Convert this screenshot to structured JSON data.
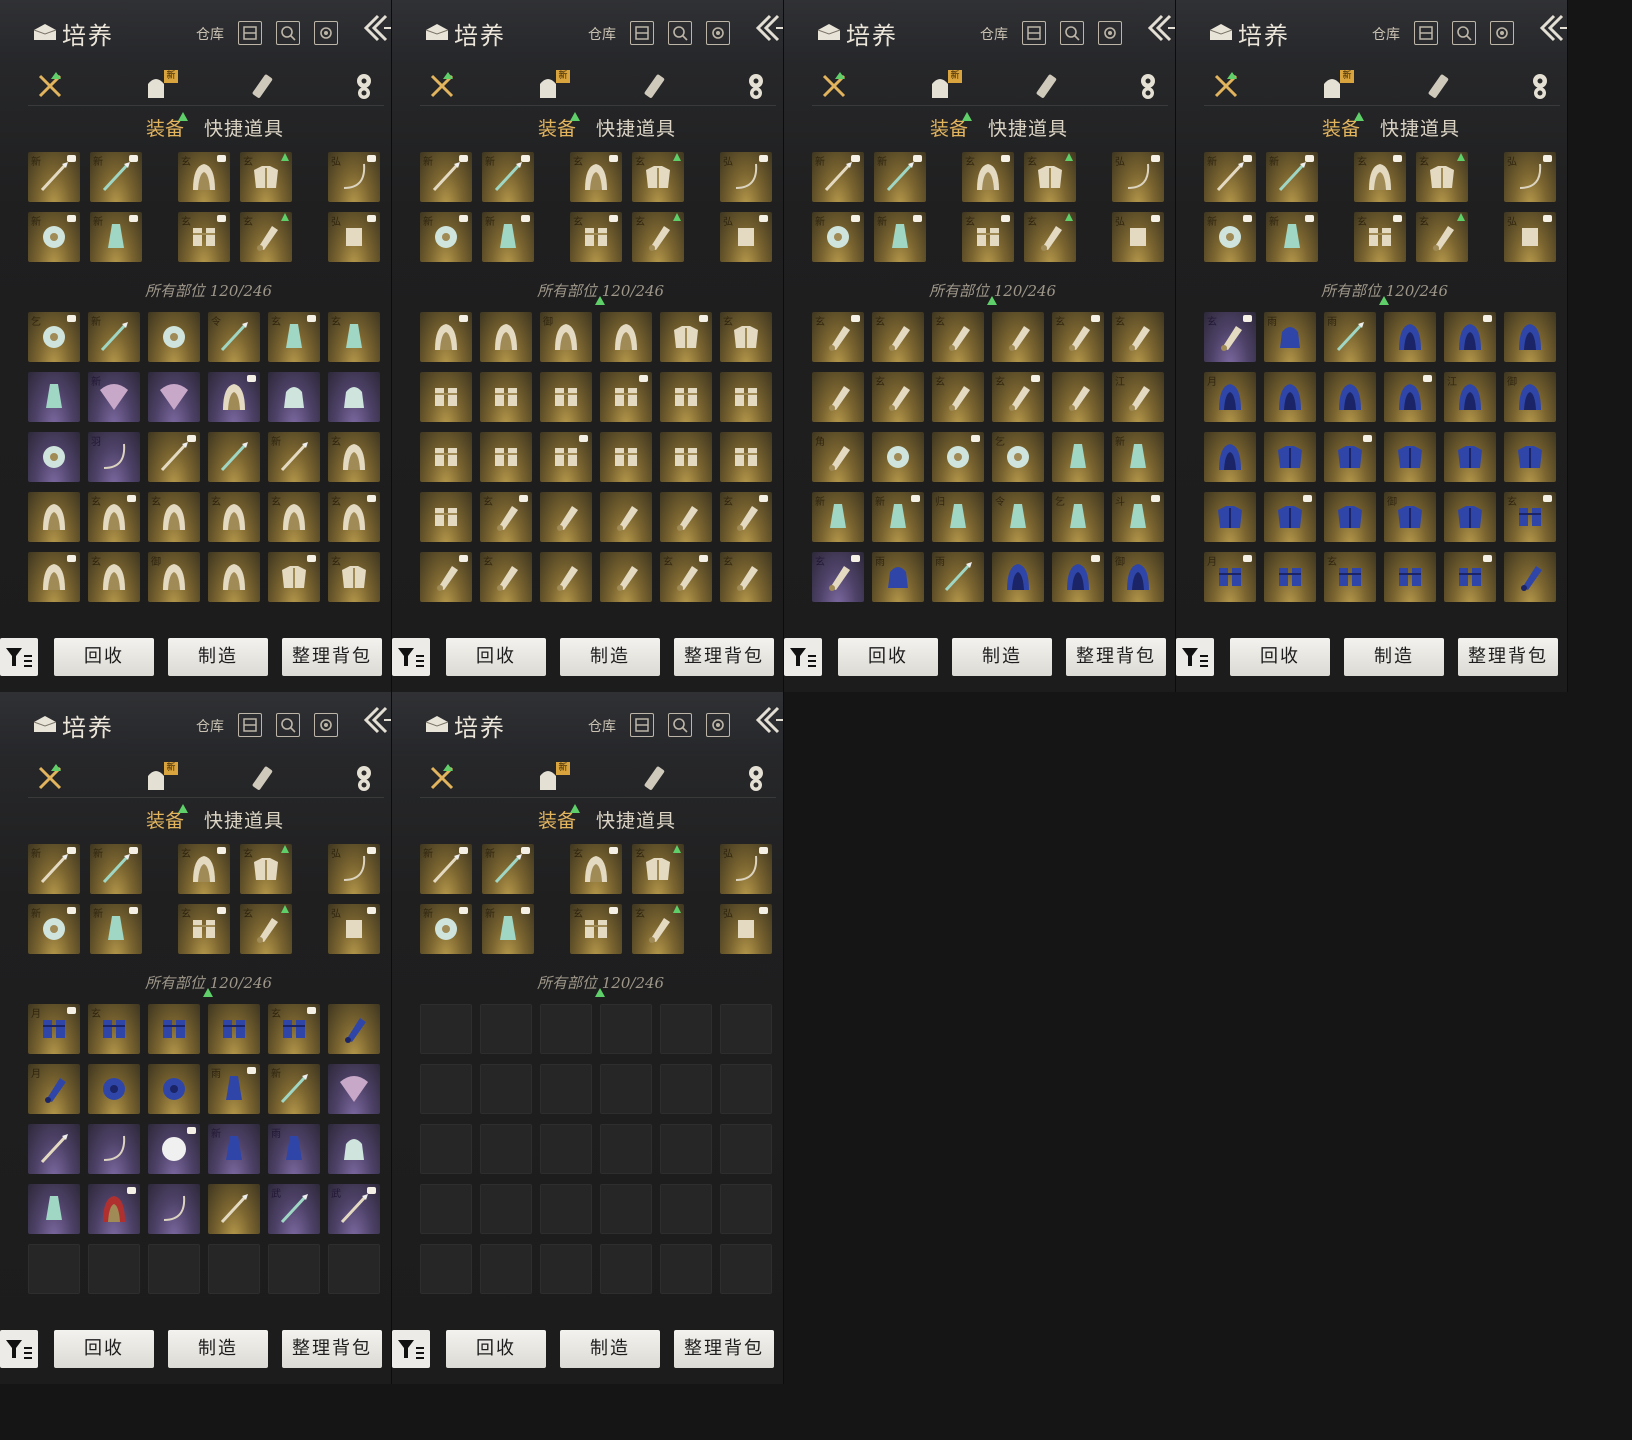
{
  "header": {
    "title": "培养",
    "warehouse_label": "仓库",
    "icons": [
      "cultivate-icon",
      "warehouse-icon",
      "search-icon",
      "settings-gear-icon",
      "back-arrows-icon"
    ]
  },
  "categories": [
    {
      "name": "weapons-icon",
      "has_upgrade": true
    },
    {
      "name": "bag-icon",
      "badge": "新"
    },
    {
      "name": "scroll-icon"
    },
    {
      "name": "token-icon"
    }
  ],
  "tabs": {
    "equip": "装备",
    "quick": "快捷道具"
  },
  "section_label": "所有部位 120/246",
  "actions": {
    "recycle": "回收",
    "craft": "制造",
    "sort": "整理背包"
  },
  "colors": {
    "accent_gold": "#e2b45e",
    "upgrade_green": "#5fcf6a",
    "rarity_gold": "#b79a4c",
    "rarity_purple": "#7d6aa2"
  },
  "equipped": [
    {
      "tag": "新",
      "icon": "sword-icon",
      "rarity": "gold"
    },
    {
      "tag": "新",
      "icon": "spear-icon",
      "rarity": "gold"
    },
    {
      "tag": "玄",
      "icon": "helmet-icon",
      "rarity": "gold"
    },
    {
      "tag": "玄",
      "icon": "armor-icon",
      "rarity": "gold"
    },
    {
      "tag": "弘",
      "icon": "bow-icon",
      "rarity": "gold"
    },
    {
      "tag": "新",
      "icon": "jade-ring-icon",
      "rarity": "gold"
    },
    {
      "tag": "新",
      "icon": "pendant-icon",
      "rarity": "gold"
    },
    {
      "tag": "玄",
      "icon": "gauntlet-icon",
      "rarity": "gold"
    },
    {
      "tag": "玄",
      "icon": "bracer-icon",
      "rarity": "gold"
    },
    {
      "tag": "弘",
      "icon": "quiver-icon",
      "rarity": "gold"
    }
  ],
  "pages": [
    {
      "rows": [
        [
          [
            "乞",
            "jade-ring-icon",
            "gold"
          ],
          [
            "新",
            "spear-icon",
            "gold"
          ],
          [
            "",
            "jade-ring-icon",
            "gold"
          ],
          [
            "令",
            "spear-icon",
            "gold"
          ],
          [
            "玄",
            "pendant-icon",
            "gold"
          ],
          [
            "玄",
            "pendant-icon",
            "gold"
          ]
        ],
        [
          [
            "",
            "pendant-icon",
            "purple"
          ],
          [
            "新",
            "fan-icon",
            "purple"
          ],
          [
            "",
            "fan-icon",
            "purple"
          ],
          [
            "",
            "helmet-icon",
            "purple"
          ],
          [
            "",
            "pouch-icon",
            "purple"
          ],
          [
            "",
            "pouch-icon",
            "purple"
          ]
        ],
        [
          [
            "",
            "jade-ring-icon",
            "purple"
          ],
          [
            "羽",
            "bow-icon",
            "purple"
          ],
          [
            "",
            "sword-icon",
            "gold"
          ],
          [
            "",
            "spear-icon",
            "gold"
          ],
          [
            "新",
            "blade-icon",
            "gold"
          ],
          [
            "玄",
            "helmet-icon",
            "gold"
          ]
        ],
        [
          [
            "",
            "helmet-icon",
            "gold"
          ],
          [
            "玄",
            "helmet-icon",
            "gold"
          ],
          [
            "玄",
            "helmet-icon",
            "gold"
          ],
          [
            "玄",
            "helmet-icon",
            "gold"
          ],
          [
            "玄",
            "helmet-icon",
            "gold"
          ],
          [
            "玄",
            "helmet-icon",
            "gold"
          ]
        ],
        [
          [
            "",
            "helmet-icon",
            "gold"
          ],
          [
            "玄",
            "helmet-icon",
            "gold"
          ],
          [
            "御",
            "helmet-icon",
            "gold"
          ],
          [
            "",
            "helmet-icon",
            "gold"
          ],
          [
            "",
            "armor-icon",
            "gold"
          ],
          [
            "玄",
            "armor-icon",
            "gold"
          ]
        ]
      ]
    },
    {
      "rows": [
        [
          [
            "",
            "helmet-icon",
            "gold"
          ],
          [
            "",
            "helmet-icon",
            "gold"
          ],
          [
            "御",
            "helmet-icon",
            "gold"
          ],
          [
            "",
            "helmet-icon",
            "gold"
          ],
          [
            "",
            "armor-icon",
            "gold"
          ],
          [
            "玄",
            "armor-icon",
            "gold"
          ]
        ],
        [
          [
            "",
            "gauntlet-icon",
            "gold"
          ],
          [
            "",
            "gauntlet-icon",
            "gold"
          ],
          [
            "",
            "gauntlet-icon",
            "gold"
          ],
          [
            "",
            "gauntlet-icon",
            "gold"
          ],
          [
            "",
            "gauntlet-icon",
            "gold"
          ],
          [
            "",
            "gauntlet-icon",
            "gold"
          ]
        ],
        [
          [
            "",
            "gauntlet-icon",
            "gold"
          ],
          [
            "",
            "gauntlet-icon",
            "gold"
          ],
          [
            "",
            "gauntlet-icon",
            "gold"
          ],
          [
            "",
            "gauntlet-icon",
            "gold"
          ],
          [
            "",
            "gauntlet-icon",
            "gold"
          ],
          [
            "",
            "gauntlet-icon",
            "gold"
          ]
        ],
        [
          [
            "",
            "gauntlet-icon",
            "gold"
          ],
          [
            "玄",
            "bracer-icon",
            "gold"
          ],
          [
            "",
            "bracer-icon",
            "gold"
          ],
          [
            "",
            "bracer-icon",
            "gold"
          ],
          [
            "",
            "bracer-icon",
            "gold"
          ],
          [
            "玄",
            "bracer-icon",
            "gold"
          ]
        ],
        [
          [
            "",
            "bracer-icon",
            "gold"
          ],
          [
            "玄",
            "bracer-icon",
            "gold"
          ],
          [
            "",
            "bracer-icon",
            "gold"
          ],
          [
            "",
            "bracer-icon",
            "gold"
          ],
          [
            "玄",
            "bracer-icon",
            "gold"
          ],
          [
            "玄",
            "bracer-icon",
            "gold"
          ]
        ]
      ]
    },
    {
      "rows": [
        [
          [
            "玄",
            "bracer-icon",
            "gold"
          ],
          [
            "玄",
            "bracer-icon",
            "gold"
          ],
          [
            "玄",
            "bracer-icon",
            "gold"
          ],
          [
            "",
            "bracer-icon",
            "gold"
          ],
          [
            "玄",
            "bracer-icon",
            "gold"
          ],
          [
            "玄",
            "bracer-icon",
            "gold"
          ]
        ],
        [
          [
            "",
            "bracer-icon",
            "gold"
          ],
          [
            "玄",
            "bracer-icon",
            "gold"
          ],
          [
            "玄",
            "bracer-icon",
            "gold"
          ],
          [
            "玄",
            "bracer-icon",
            "gold"
          ],
          [
            "",
            "bracer-icon",
            "gold"
          ],
          [
            "江",
            "bracer-icon",
            "gold"
          ]
        ],
        [
          [
            "角",
            "bracer-icon",
            "gold"
          ],
          [
            "",
            "jade-ring-icon",
            "gold"
          ],
          [
            "",
            "jade-ring-icon",
            "gold"
          ],
          [
            "乞",
            "jade-ring-icon",
            "gold"
          ],
          [
            "",
            "pendant-icon",
            "gold"
          ],
          [
            "新",
            "pendant-icon",
            "gold"
          ]
        ],
        [
          [
            "新",
            "pendant-icon",
            "gold"
          ],
          [
            "新",
            "pendant-icon",
            "gold"
          ],
          [
            "归",
            "pendant-icon",
            "gold"
          ],
          [
            "令",
            "pendant-icon",
            "gold"
          ],
          [
            "乞",
            "pendant-icon",
            "gold"
          ],
          [
            "斗",
            "pendant-icon",
            "gold"
          ]
        ],
        [
          [
            "玄",
            "bracer-icon",
            "purple"
          ],
          [
            "雨",
            "blue-pouch-icon",
            "gold"
          ],
          [
            "雨",
            "blue-spear-icon",
            "gold"
          ],
          [
            "",
            "blue-helmet-icon",
            "gold"
          ],
          [
            "",
            "blue-helmet-icon",
            "gold"
          ],
          [
            "御",
            "blue-helmet-icon",
            "gold"
          ]
        ]
      ]
    },
    {
      "rows": [
        [
          [
            "玄",
            "bracer-icon",
            "purple"
          ],
          [
            "雨",
            "blue-pouch-icon",
            "gold"
          ],
          [
            "雨",
            "blue-spear-icon",
            "gold"
          ],
          [
            "",
            "blue-helmet-icon",
            "gold"
          ],
          [
            "",
            "blue-helmet-icon",
            "gold"
          ],
          [
            "",
            "blue-helmet-icon",
            "gold"
          ]
        ],
        [
          [
            "月",
            "blue-helmet-icon",
            "gold"
          ],
          [
            "",
            "blue-helmet-icon",
            "gold"
          ],
          [
            "",
            "blue-helmet-icon",
            "gold"
          ],
          [
            "",
            "blue-helmet-icon",
            "gold"
          ],
          [
            "江",
            "blue-helmet-icon",
            "gold"
          ],
          [
            "御",
            "blue-helmet-icon",
            "gold"
          ]
        ],
        [
          [
            "",
            "blue-helmet-icon",
            "gold"
          ],
          [
            "",
            "blue-armor-icon",
            "gold"
          ],
          [
            "",
            "blue-armor-icon",
            "gold"
          ],
          [
            "",
            "blue-armor-icon",
            "gold"
          ],
          [
            "",
            "blue-armor-icon",
            "gold"
          ],
          [
            "",
            "blue-armor-icon",
            "gold"
          ]
        ],
        [
          [
            "",
            "blue-armor-icon",
            "gold"
          ],
          [
            "",
            "blue-armor-icon",
            "gold"
          ],
          [
            "",
            "blue-armor-icon",
            "gold"
          ],
          [
            "御",
            "blue-armor-icon",
            "gold"
          ],
          [
            "",
            "blue-armor-icon",
            "gold"
          ],
          [
            "玄",
            "blue-gauntlet-icon",
            "gold"
          ]
        ],
        [
          [
            "月",
            "blue-gauntlet-icon",
            "gold"
          ],
          [
            "",
            "blue-gauntlet-icon",
            "gold"
          ],
          [
            "玄",
            "blue-gauntlet-icon",
            "gold"
          ],
          [
            "",
            "blue-gauntlet-icon",
            "gold"
          ],
          [
            "",
            "blue-gauntlet-icon",
            "gold"
          ],
          [
            "",
            "blue-bracer-icon",
            "gold"
          ]
        ]
      ]
    },
    {
      "rows": [
        [
          [
            "月",
            "blue-gauntlet-icon",
            "gold"
          ],
          [
            "玄",
            "blue-gauntlet-icon",
            "gold"
          ],
          [
            "",
            "blue-gauntlet-icon",
            "gold"
          ],
          [
            "",
            "blue-gauntlet-icon",
            "gold"
          ],
          [
            "玄",
            "blue-gauntlet-icon",
            "gold"
          ],
          [
            "",
            "blue-bracer-icon",
            "gold"
          ]
        ],
        [
          [
            "月",
            "blue-bracer-icon",
            "gold"
          ],
          [
            "",
            "blue-ring-icon",
            "gold"
          ],
          [
            "",
            "blue-ring-icon",
            "gold"
          ],
          [
            "雨",
            "blue-pendant-icon",
            "gold"
          ],
          [
            "新",
            "blue-spear-icon",
            "gold"
          ],
          [
            "",
            "fan-icon",
            "purple"
          ]
        ],
        [
          [
            "",
            "blade-icon",
            "purple"
          ],
          [
            "",
            "rope-icon",
            "purple"
          ],
          [
            "",
            "fur-icon",
            "purple"
          ],
          [
            "新",
            "blue-pendant-icon",
            "purple"
          ],
          [
            "雨",
            "blue-pendant-icon",
            "purple"
          ],
          [
            "",
            "pouch-icon",
            "purple"
          ]
        ],
        [
          [
            "",
            "pendant-icon",
            "purple"
          ],
          [
            "",
            "red-helmet-icon",
            "purple"
          ],
          [
            "",
            "chain-icon",
            "purple"
          ],
          [
            "",
            "sword-icon",
            "gold"
          ],
          [
            "武",
            "spear-icon",
            "purple"
          ],
          [
            "武",
            "blade-icon",
            "purple"
          ]
        ],
        [
          [
            "",
            "",
            "empty"
          ],
          [
            "",
            "",
            "empty"
          ],
          [
            "",
            "",
            "empty"
          ],
          [
            "",
            "",
            "empty"
          ],
          [
            "",
            "",
            "empty"
          ],
          [
            "",
            "",
            "empty"
          ]
        ]
      ]
    },
    {
      "rows": [
        [
          [
            "",
            "",
            "empty"
          ],
          [
            "",
            "",
            "empty"
          ],
          [
            "",
            "",
            "empty"
          ],
          [
            "",
            "",
            "empty"
          ],
          [
            "",
            "",
            "empty"
          ],
          [
            "",
            "",
            "empty"
          ]
        ],
        [
          [
            "",
            "",
            "empty"
          ],
          [
            "",
            "",
            "empty"
          ],
          [
            "",
            "",
            "empty"
          ],
          [
            "",
            "",
            "empty"
          ],
          [
            "",
            "",
            "empty"
          ],
          [
            "",
            "",
            "empty"
          ]
        ],
        [
          [
            "",
            "",
            "empty"
          ],
          [
            "",
            "",
            "empty"
          ],
          [
            "",
            "",
            "empty"
          ],
          [
            "",
            "",
            "empty"
          ],
          [
            "",
            "",
            "empty"
          ],
          [
            "",
            "",
            "empty"
          ]
        ],
        [
          [
            "",
            "",
            "empty"
          ],
          [
            "",
            "",
            "empty"
          ],
          [
            "",
            "",
            "empty"
          ],
          [
            "",
            "",
            "empty"
          ],
          [
            "",
            "",
            "empty"
          ],
          [
            "",
            "",
            "empty"
          ]
        ],
        [
          [
            "",
            "",
            "empty"
          ],
          [
            "",
            "",
            "empty"
          ],
          [
            "",
            "",
            "empty"
          ],
          [
            "",
            "",
            "empty"
          ],
          [
            "",
            "",
            "empty"
          ],
          [
            "",
            "",
            "empty"
          ]
        ]
      ]
    }
  ]
}
